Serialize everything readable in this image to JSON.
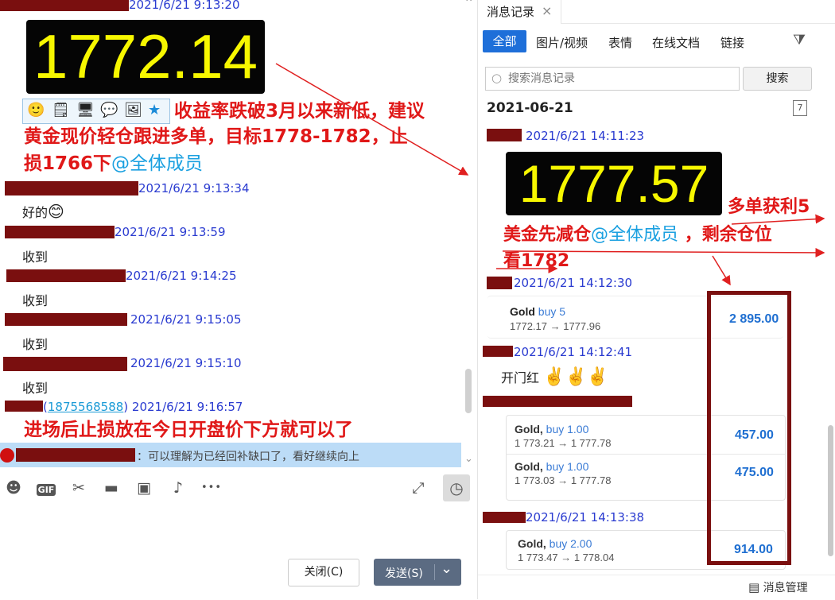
{
  "chat": {
    "messages": [
      {
        "time": "2021/6/21 9:13:20"
      },
      {
        "time": "2021/6/21 9:13:34",
        "text": "好的"
      },
      {
        "time": "2021/6/21 9:13:59",
        "text": "收到"
      },
      {
        "time": "2021/6/21 9:14:25",
        "text": "收到"
      },
      {
        "time": "2021/6/21 9:15:05",
        "text": "收到"
      },
      {
        "time": "2021/6/21 9:15:10",
        "text": "收到"
      },
      {
        "time": "2021/6/21 9:16:57",
        "qq": "1875568588"
      }
    ],
    "ticker_price": "1772.14",
    "advice_line1": "收益率跌破3月以来新低，建议",
    "advice_line2": "黄金现价轻仓跟进多单，目标1778-1782，止",
    "advice_line3": "损1766下",
    "mention": "@全体成员",
    "stoploss_text": "进场后止损放在今日开盘价下方就可以了",
    "notice_text": "：可以理解为已经回补缺口了，看好继续向上",
    "emoji_smile": "😊"
  },
  "toolbar": {
    "gif_label": "GIF",
    "more_label": "•••",
    "close_button": "关闭(C)",
    "send_button": "发送(S)",
    "dropdown_glyph": "⌄"
  },
  "history": {
    "tab_title": "消息记录",
    "close_glyph": "×",
    "tabs": [
      "全部",
      "图片/视频",
      "表情",
      "在线文档",
      "链接"
    ],
    "search_placeholder": "搜索消息记录",
    "search_button": "搜索",
    "date": "2021-06-21",
    "calendar_glyph": "7",
    "entries": [
      {
        "time": "2021/6/21 14:11:23"
      },
      {
        "time": "2021/6/21 14:12:30"
      },
      {
        "time": "2021/6/21 14:12:41",
        "text": "开门红",
        "emojis": "✌️✌️✌️"
      },
      {
        "time": "2021/6/21 14:13:38"
      }
    ],
    "ticker_price": "1777.57",
    "profit_text": "多单获利5",
    "reduce_text_a": "美金先减仓",
    "reduce_text_b": "，剩余仓位",
    "target_text": "看1782",
    "mention": "@全体成员",
    "trades": [
      {
        "symbol": "Gold",
        "action": "buy 5",
        "prices": "1772.17 → 1777.96",
        "pnl": "2 895.00"
      },
      {
        "symbol": "Gold,",
        "action": "buy 1.00",
        "prices": "1 773.21 → 1 777.78",
        "pnl": "457.00"
      },
      {
        "symbol": "Gold,",
        "action": "buy 1.00",
        "prices": "1 773.03 → 1 777.78",
        "pnl": "475.00"
      },
      {
        "symbol": "Gold,",
        "action": "buy 2.00",
        "prices": "1 773.47 → 1 778.04",
        "pnl": "914.00"
      }
    ],
    "manage_button": "消息管理"
  },
  "colors": {
    "accent": "#1e6fd9",
    "redaction": "#7a0f0f",
    "annotation_red": "#e02020",
    "timestamp_blue": "#2a3bd0",
    "ticker_yellow": "#f7f700",
    "notice_bg": "#bcdcf7"
  }
}
